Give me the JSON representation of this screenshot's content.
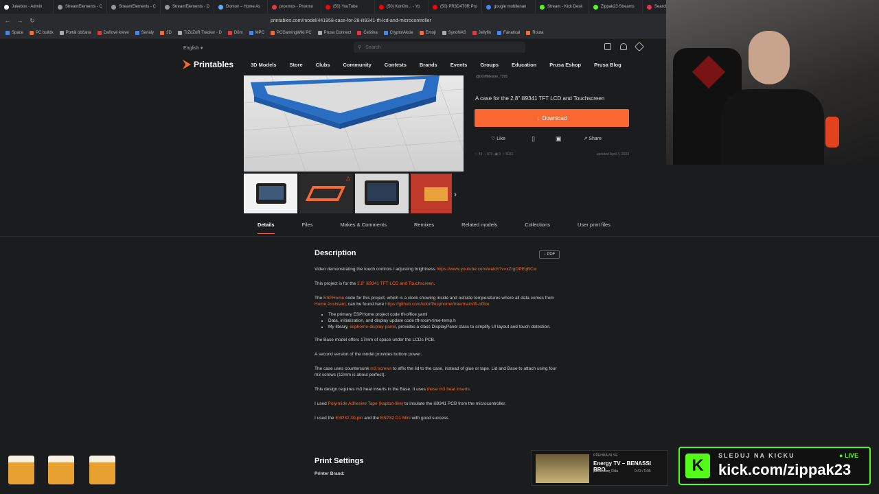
{
  "browser": {
    "tabs": [
      "Jukebox - Admin",
      "StreamElements - C",
      "StreamElements - C",
      "StreamElements - D",
      "Domov – Home As",
      "proxmox - Proxmo",
      "(50) YouTube",
      "(50) Kon0m... - Yo",
      "(50) PR3D4T0R Pro",
      "google mobilenan",
      "Stream - Kick Desk",
      "Zippak23 Streams",
      "Search m"
    ],
    "url": "printables.com/model/441958-case-for-28-ili9341-tft-lcd-and-microcontroller",
    "bookmarks": [
      "Space",
      "PC buildx",
      "Portál občana",
      "Daňové kreve",
      "Serialy",
      "3D",
      "TrZoZoR Tracker - D",
      "Dům",
      "MPC",
      "PCGamingWiki PC",
      "Prusa Connect",
      "Čeština",
      "Crypto/Akcie",
      "Emoji",
      "SynoNAS",
      "Jellyfin",
      "Fanatical",
      "Routa"
    ]
  },
  "header": {
    "language": "English",
    "search_placeholder": "Search",
    "logo": "Printables",
    "nav": [
      "3D Models",
      "Store",
      "Clubs",
      "Community",
      "Contests",
      "Brands",
      "Events",
      "Groups",
      "Education",
      "Prusa Eshop",
      "Prusa Blog"
    ]
  },
  "model": {
    "author": "@DorffMeister_7295",
    "summary": "A case for the 2.8\" ili9341 TFT LCD and Touchscreen",
    "download": "Download",
    "like": "Like",
    "share": "Share",
    "stats": {
      "likes": "49",
      "downloads": "870",
      "makes": "0",
      "views": "5031",
      "updated": "updated April 3, 2023"
    }
  },
  "tabs": [
    {
      "label": "Details",
      "count": ""
    },
    {
      "label": "Files",
      "count": "6"
    },
    {
      "label": "Makes & Comments",
      "count": "0"
    },
    {
      "label": "Remixes",
      "count": "0"
    },
    {
      "label": "Related models",
      "count": "6"
    },
    {
      "label": "Collections",
      "count": "58"
    },
    {
      "label": "User print files",
      "count": "0"
    }
  ],
  "description": {
    "heading": "Description",
    "pdf": "PDF",
    "p1": "Video demonstrating the touch controls / adjusting brightness ",
    "p1_link": "https://www.youtube.com/watch?v=xZrgOPEqBCw",
    "p2": "This project is for the ",
    "p2_link": "2.8\" ili9341 TFT LCD and Touchscreen",
    "p3a": "The ",
    "p3_link1": "ESPHome",
    "p3b": " code for this project, which is a clock showing inside and outside temperatures where all data comes from ",
    "p3_link2": "Home Assistant",
    "p3c": ", can be found here ",
    "p3_link3": "https://github.com/kdorff/esphome/tree/main/tft-office",
    "li1": "The primary ESPHome project code tft-office.yaml",
    "li2": "Data, initialization, and display update code tft-room-time-temp.h",
    "li3a": "My library, ",
    "li3_link": "esphome-display-panel",
    "li3b": ", provides a class DisplayPanel class to simplify UI layout and touch detection.",
    "p4": "The Base model offers 17mm of space under the LCDs PCB.",
    "p5": "A second version of the model provides bottom power.",
    "p6a": "The case uses countersunk ",
    "p6_link": "m3 screws",
    "p6b": " to affix the lid to the case, instead of glue or tape. Lid and Base to attach using four m3 screws (12mm is about perfect).",
    "p7a": "This design requires m3 heat inserts in the Base. It uses ",
    "p7_link": "these m3 heat inserts",
    "p7b": ".",
    "p8a": "I used ",
    "p8_link": "Polyimide Adhesive Tape (kapton-like)",
    "p8b": " to insulate the ili9341 PCB from the microcontroller.",
    "p9a": "I used the ",
    "p9_link1": "ESP32 30-pin",
    "p9b": " and the ",
    "p9_link2": "ESP32 D1 Mini",
    "p9c": " with good success",
    "print_heading": "Print Settings",
    "printer_brand": "Printer Brand:"
  },
  "overlay": {
    "kick_top": "SLEDUJ NA KICKU",
    "kick_live": "LIVE",
    "kick_url": "kick.com/zippak23",
    "kick_logo": "K",
    "np_label": "PŘEHRÁVÁ SE",
    "np_title": "Energy TV – BENASSI BRO...",
    "np_by": "poslal Iam_Olda",
    "np_time": "0:43 / 5:05"
  },
  "colors": {
    "accent": "#fa6831",
    "kick": "#53fc18",
    "background": "#1b1c1e"
  }
}
